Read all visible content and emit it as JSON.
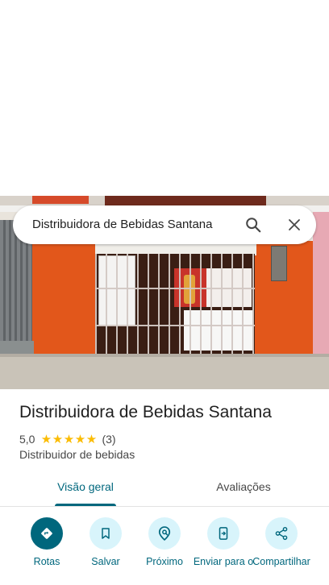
{
  "search": {
    "query": "Distribuidora de Bebidas Santana"
  },
  "place": {
    "name": "Distribuidora de Bebidas Santana",
    "rating": "5,0",
    "stars": 5,
    "review_count": "(3)",
    "category": "Distribuidor de bebidas"
  },
  "tabs": [
    {
      "label": "Visão geral",
      "selected": true
    },
    {
      "label": "Avaliações",
      "selected": false
    }
  ],
  "actions": [
    {
      "label": "Rotas",
      "icon": "directions-icon"
    },
    {
      "label": "Salvar",
      "icon": "bookmark-icon"
    },
    {
      "label": "Próximo",
      "icon": "nearby-icon"
    },
    {
      "label": "Enviar para o",
      "icon": "send-to-phone-icon"
    },
    {
      "label": "Compartilhar",
      "icon": "share-icon"
    }
  ],
  "colors": {
    "accent": "#00677d",
    "action_bg": "#d8f4fb",
    "star": "#fbbc04"
  }
}
